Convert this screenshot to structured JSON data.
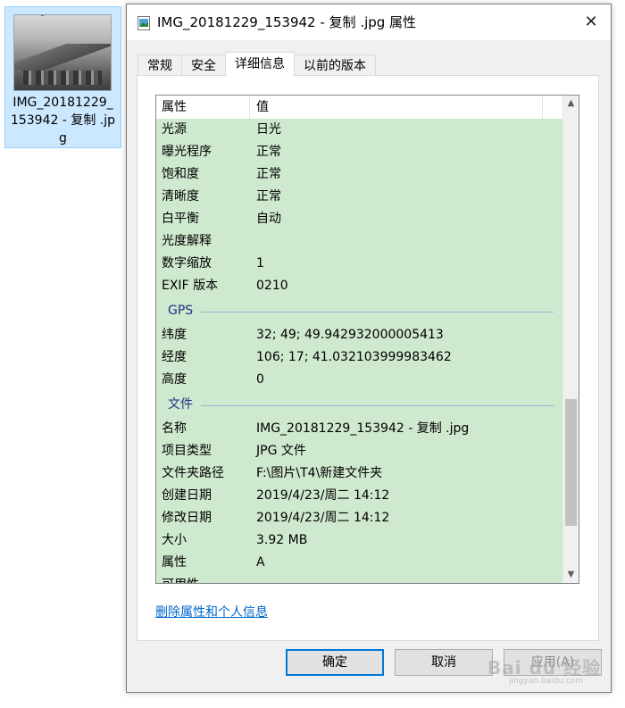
{
  "desktop_file": {
    "name": "IMG_20181229_153942 - 复制 .jpg"
  },
  "window": {
    "title": "IMG_20181229_153942 - 复制 .jpg 属性",
    "close_glyph": "✕"
  },
  "tabs": [
    {
      "label": "常规",
      "active": false
    },
    {
      "label": "安全",
      "active": false
    },
    {
      "label": "详细信息",
      "active": true
    },
    {
      "label": "以前的版本",
      "active": false
    }
  ],
  "list": {
    "header": {
      "property": "属性",
      "value": "值"
    },
    "rows_top": [
      {
        "k": "光源",
        "v": "日光"
      },
      {
        "k": "曝光程序",
        "v": "正常"
      },
      {
        "k": "饱和度",
        "v": "正常"
      },
      {
        "k": "清晰度",
        "v": "正常"
      },
      {
        "k": "白平衡",
        "v": "自动"
      },
      {
        "k": "光度解释",
        "v": ""
      },
      {
        "k": "数字缩放",
        "v": "1"
      },
      {
        "k": "EXIF 版本",
        "v": "0210"
      }
    ],
    "group_gps": "GPS",
    "rows_gps": [
      {
        "k": "纬度",
        "v": "32; 49; 49.942932000005413"
      },
      {
        "k": "经度",
        "v": "106; 17; 41.032103999983462"
      },
      {
        "k": "高度",
        "v": "0"
      }
    ],
    "group_file": "文件",
    "rows_file": [
      {
        "k": "名称",
        "v": "IMG_20181229_153942 - 复制 .jpg"
      },
      {
        "k": "项目类型",
        "v": "JPG 文件"
      },
      {
        "k": "文件夹路径",
        "v": "F:\\图片\\T4\\新建文件夹"
      },
      {
        "k": "创建日期",
        "v": "2019/4/23/周二 14:12"
      },
      {
        "k": "修改日期",
        "v": "2019/4/23/周二 14:12"
      },
      {
        "k": "大小",
        "v": "3.92 MB"
      },
      {
        "k": "属性",
        "v": "A"
      },
      {
        "k": "可用性",
        "v": ""
      }
    ]
  },
  "link": {
    "remove": "删除属性和个人信息"
  },
  "buttons": {
    "ok": "确定",
    "cancel": "取消",
    "apply": "应用(A)"
  },
  "watermark": {
    "text": "Bai du 经验",
    "sub": "jingyan.baidu.com"
  },
  "colors": {
    "list_bg": "#cfe9cf",
    "group_label": "#1e3287",
    "link": "#0066cc",
    "ok_border": "#0078d7"
  }
}
